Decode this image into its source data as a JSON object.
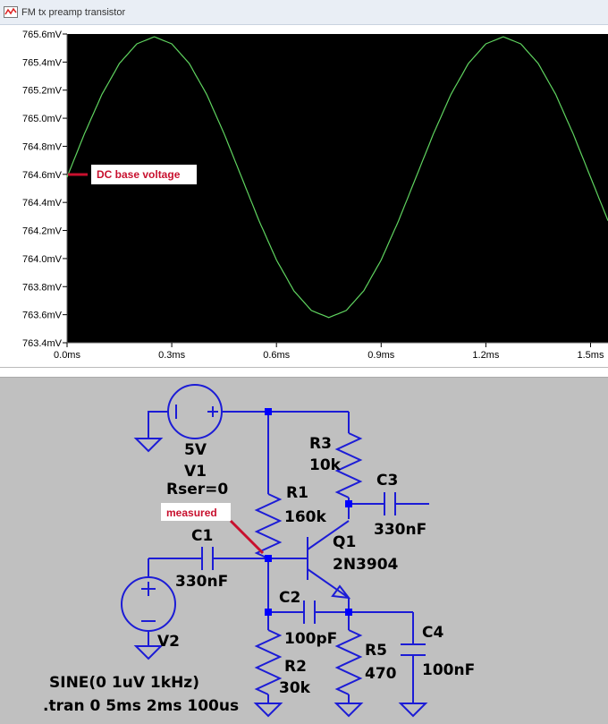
{
  "window": {
    "title": "FM tx preamp transistor"
  },
  "plot": {
    "y_ticks": [
      "765.6mV",
      "765.4mV",
      "765.2mV",
      "765.0mV",
      "764.8mV",
      "764.6mV",
      "764.4mV",
      "764.2mV",
      "764.0mV",
      "763.8mV",
      "763.6mV",
      "763.4mV"
    ],
    "x_ticks": [
      "0.0ms",
      "0.3ms",
      "0.6ms",
      "0.9ms",
      "1.2ms",
      "1.5ms"
    ],
    "annotation": "DC base voltage",
    "colors": {
      "background": "#000000",
      "trace": "#5fd35f",
      "annotation": "#c8102e"
    }
  },
  "chart_data": {
    "type": "line",
    "title": "",
    "xlabel": "",
    "ylabel": "",
    "x_unit": "ms",
    "y_unit": "mV",
    "xlim": [
      0,
      1.55
    ],
    "ylim": [
      763.4,
      765.6
    ],
    "grid": false,
    "legend": "none",
    "series": [
      {
        "x": [
          0.0,
          0.05,
          0.1,
          0.15,
          0.2,
          0.25,
          0.3,
          0.35,
          0.4,
          0.45,
          0.5,
          0.55,
          0.6,
          0.65,
          0.7,
          0.75,
          0.8,
          0.85,
          0.9,
          0.95,
          1.0,
          1.05,
          1.1,
          1.15,
          1.2,
          1.25,
          1.3,
          1.35,
          1.4,
          1.45,
          1.5,
          1.55
        ],
        "y": [
          764.58,
          764.89,
          765.17,
          765.39,
          765.53,
          765.58,
          765.53,
          765.39,
          765.17,
          764.89,
          764.58,
          764.27,
          763.99,
          763.77,
          763.63,
          763.58,
          763.63,
          763.77,
          763.99,
          764.27,
          764.58,
          764.89,
          765.17,
          765.39,
          765.53,
          765.58,
          765.53,
          765.39,
          765.17,
          764.89,
          764.58,
          764.27
        ],
        "color": "#5fd35f"
      }
    ]
  },
  "schematic": {
    "labels": {
      "v1_value": "5V",
      "v1_name": "V1",
      "v1_rser": "Rser=0",
      "r1_name": "R1",
      "r1_value": "160k",
      "r3_name": "R3",
      "r3_value": "10k",
      "c3_name": "C3",
      "c3_value": "330nF",
      "c1_name": "C1",
      "c1_value": "330nF",
      "q1_name": "Q1",
      "q1_model": "2N3904",
      "c2_name": "C2",
      "c2_value": "100pF",
      "c4_name": "C4",
      "c4_value": "100nF",
      "r5_name": "R5",
      "r5_value": "470",
      "r2_name": "R2",
      "r2_value": "30k",
      "v2_name": "V2",
      "sine": "SINE(0 1uV 1kHz)",
      "tran": ".tran 0 5ms 2ms 100us"
    },
    "annotation": "measured",
    "colors": {
      "wire": "#1c1cd6",
      "junction": "#0000ff",
      "background": "#c0c0c0"
    }
  }
}
